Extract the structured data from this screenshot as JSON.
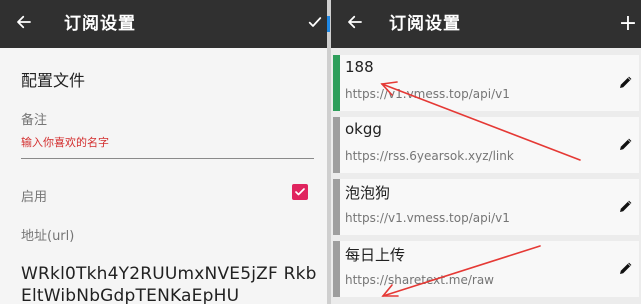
{
  "left_screen": {
    "appbar": {
      "back_icon": "arrow-left-icon",
      "title": "订阅设置",
      "confirm_icon": "check-icon"
    },
    "section_title": "配置文件",
    "remark": {
      "label": "备注",
      "placeholder": "输入你喜欢的名字",
      "value": ""
    },
    "enable": {
      "label": "启用",
      "checked": true
    },
    "url": {
      "label": "地址(url)",
      "value": "WRkl0Tkh4Y2RUUmxNVE5jZF RkbEltWibNbGdpTENKaEpHU"
    }
  },
  "right_screen": {
    "appbar": {
      "back_icon": "arrow-left-icon",
      "title": "订阅设置",
      "add_icon": "plus-icon",
      "add_label": "+"
    },
    "subscriptions": [
      {
        "name": "188",
        "url": "https://v1.vmess.top/api/v1",
        "active": true
      },
      {
        "name": "okgg",
        "url": "https://rss.6yearsok.xyz/link",
        "active": false
      },
      {
        "name": "泡泡狗",
        "url": "https://v1.vmess.top/api/v1",
        "active": false
      },
      {
        "name": "每日上传",
        "url": "https://sharetext.me/raw",
        "active": false
      }
    ]
  },
  "colors": {
    "appbar": "#303030",
    "checkbox": "#e0245e",
    "placeholder": "#d32f2f",
    "active_marker": "#2e9e5b",
    "inactive_marker": "#9e9e9e",
    "annotation_arrow": "#e53935"
  }
}
